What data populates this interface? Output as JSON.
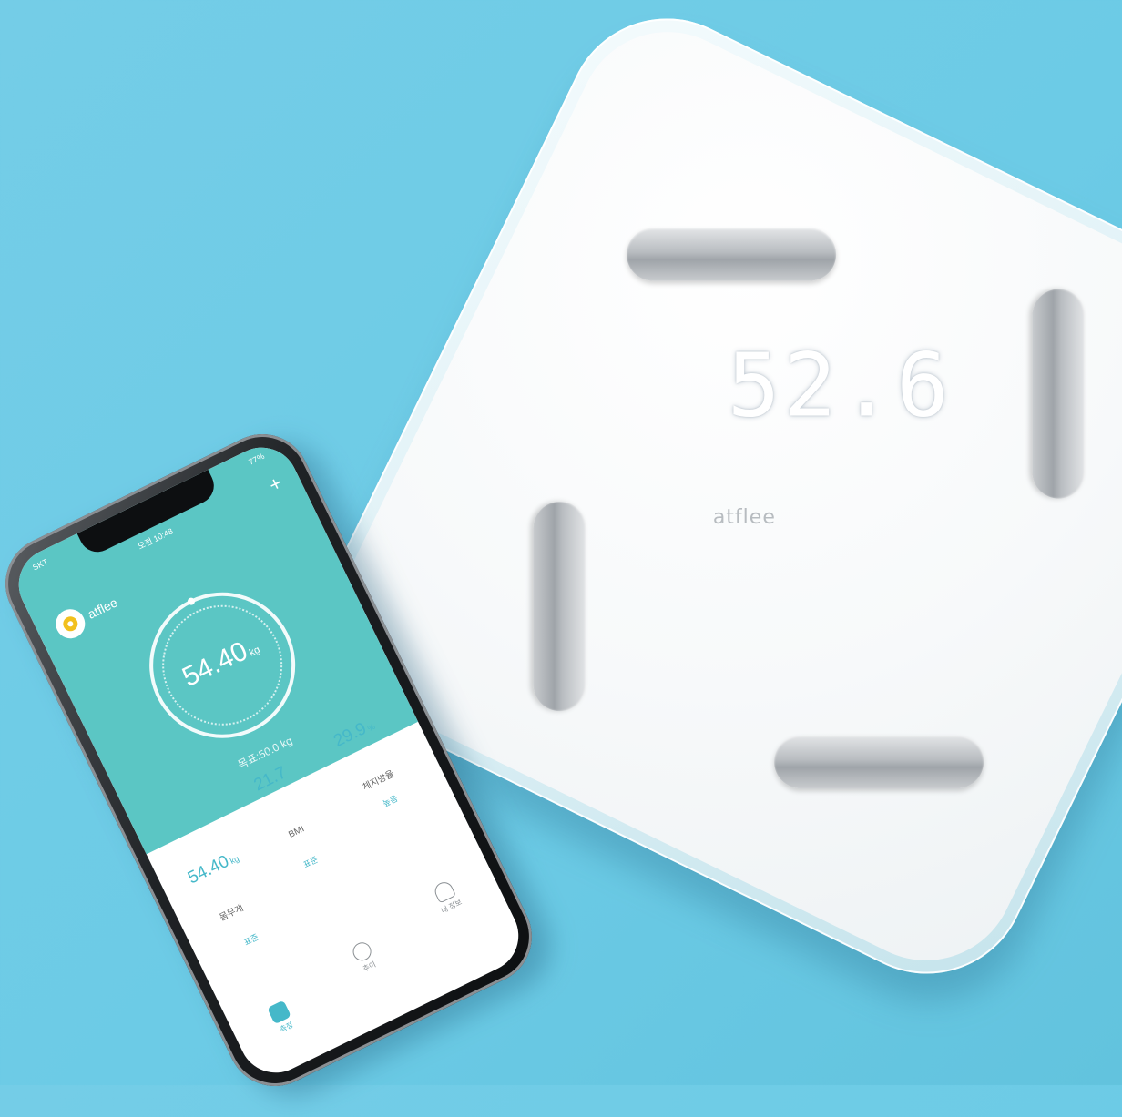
{
  "scale": {
    "display_reading": "52.6",
    "brand": "atflee"
  },
  "phone": {
    "status": {
      "carrier": "SKT",
      "time": "오전 10:48",
      "battery": "77%"
    },
    "app_name": "atflee",
    "add_label": "+",
    "weight": {
      "value": "54.40",
      "unit": "kg"
    },
    "goal": "목표:50.0 kg",
    "stats": {
      "weight": {
        "value": "54.40",
        "unit": "kg",
        "name": "몸무게",
        "status": "표준"
      },
      "bmi": {
        "value": "21.7",
        "name": "BMI",
        "status": "표준"
      },
      "body_fat": {
        "value": "29.9",
        "unit": "%",
        "name": "체지방율",
        "status": "높음"
      }
    },
    "tabs": [
      {
        "label": "측정"
      },
      {
        "label": "추이"
      },
      {
        "label": "내 정보"
      }
    ]
  },
  "colors": {
    "background": "#6ccbe6",
    "app_accent": "#5bc6c4",
    "logo_yellow": "#f2c01e"
  }
}
